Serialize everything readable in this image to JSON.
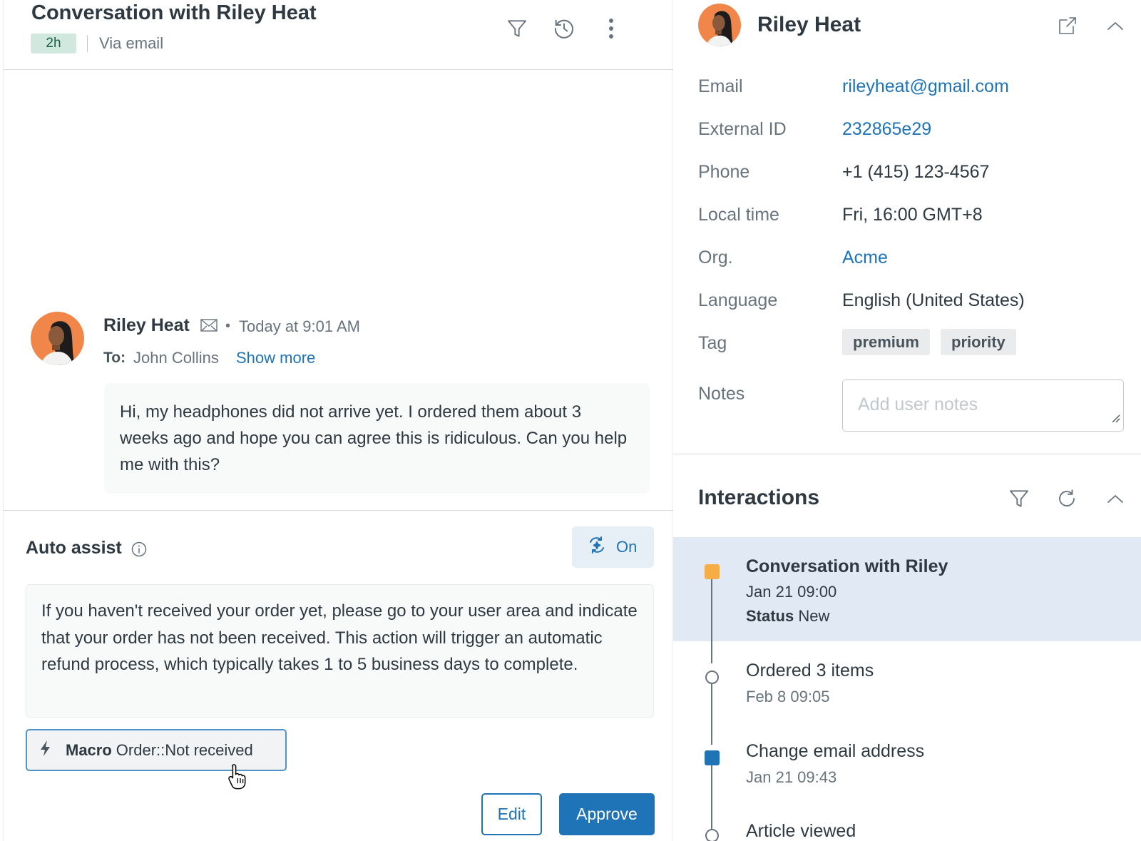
{
  "conversation": {
    "title": "Conversation with Riley Heat",
    "age_badge": "2h",
    "channel": "Via email"
  },
  "header_icons": [
    "filter-icon",
    "history-icon",
    "more-vertical-icon"
  ],
  "message": {
    "sender": "Riley Heat",
    "timestamp": "Today at 9:01 AM",
    "to_label": "To:",
    "to_name": "John Collins",
    "show_more": "Show more",
    "body": "Hi, my headphones did not arrive yet. I ordered them about 3 weeks ago and hope you can agree this is ridiculous. Can you help me with this?"
  },
  "auto_assist": {
    "title": "Auto assist",
    "toggle_label": "On",
    "suggestion": "If you haven't received your order yet, please go to your user area and indicate that your order has not been received. This action will trigger an automatic refund process, which typically takes 1 to 5 business days to complete.",
    "macro_prefix": "Macro",
    "macro_name": "Order::Not received",
    "edit_label": "Edit",
    "approve_label": "Approve"
  },
  "user": {
    "name": "Riley Heat",
    "fields": {
      "email_label": "Email",
      "email": "rileyheat@gmail.com",
      "external_id_label": "External ID",
      "external_id": "232865e29",
      "phone_label": "Phone",
      "phone": "+1 (415) 123-4567",
      "local_time_label": "Local time",
      "local_time": "Fri, 16:00 GMT+8",
      "org_label": "Org.",
      "org": "Acme",
      "language_label": "Language",
      "language": "English (United States)",
      "tag_label": "Tag",
      "tags": [
        "premium",
        "priority"
      ],
      "notes_label": "Notes",
      "notes_placeholder": "Add user notes"
    }
  },
  "interactions": {
    "title": "Interactions",
    "items": [
      {
        "title": "Conversation with Riley",
        "date": "Jan 21 09:00",
        "status_label": "Status",
        "status": "New",
        "marker": "orange-square",
        "active": true
      },
      {
        "title": "Ordered 3 items",
        "date": "Feb 8 09:05",
        "marker": "circle"
      },
      {
        "title": "Change email address",
        "date": "Jan 21 09:43",
        "marker": "blue-square"
      },
      {
        "title": "Article viewed",
        "marker": "circle"
      }
    ]
  },
  "colors": {
    "accent_blue": "#1f73b7",
    "badge_green_bg": "#d1e8df",
    "active_row_bg": "#e1e9f5",
    "marker_orange": "#f6ad45",
    "marker_blue": "#1f73b7"
  }
}
